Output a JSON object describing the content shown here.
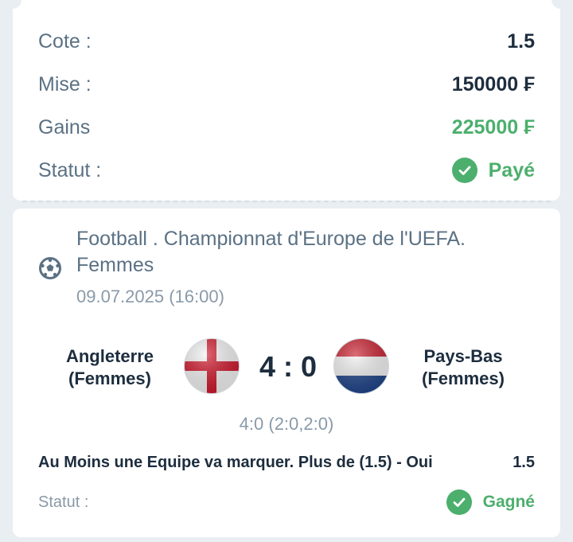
{
  "summary": {
    "odds_label": "Cote :",
    "odds_value": "1.5",
    "stake_label": "Mise :",
    "stake_value": "150000 ₣",
    "winnings_label": "Gains",
    "winnings_value": "225000 ₣",
    "status_label": "Statut :",
    "status_value": "Payé"
  },
  "event": {
    "league": "Football . Championnat d'Europe de l'UEFA. Femmes",
    "datetime": "09.07.2025 (16:00)",
    "home_line1": "Angleterre",
    "home_line2": "(Femmes)",
    "away_line1": "Pays-Bas",
    "away_line2": "(Femmes)",
    "score": "4 : 0",
    "score_detail": "4:0 (2:0,2:0)",
    "market": "Au Moins une Equipe va marquer. Plus de (1.5) - Oui",
    "market_odds": "1.5",
    "status_label": "Statut :",
    "status_value": "Gagné"
  },
  "colors": {
    "accent_green": "#4caf6d",
    "label_gray": "#5b7184",
    "dark_text": "#1d2d3e"
  },
  "icons": {
    "status_check": "check-circle-icon",
    "sport": "soccer-ball-icon",
    "home_flag": "england-flag-icon",
    "away_flag": "netherlands-flag-icon"
  }
}
